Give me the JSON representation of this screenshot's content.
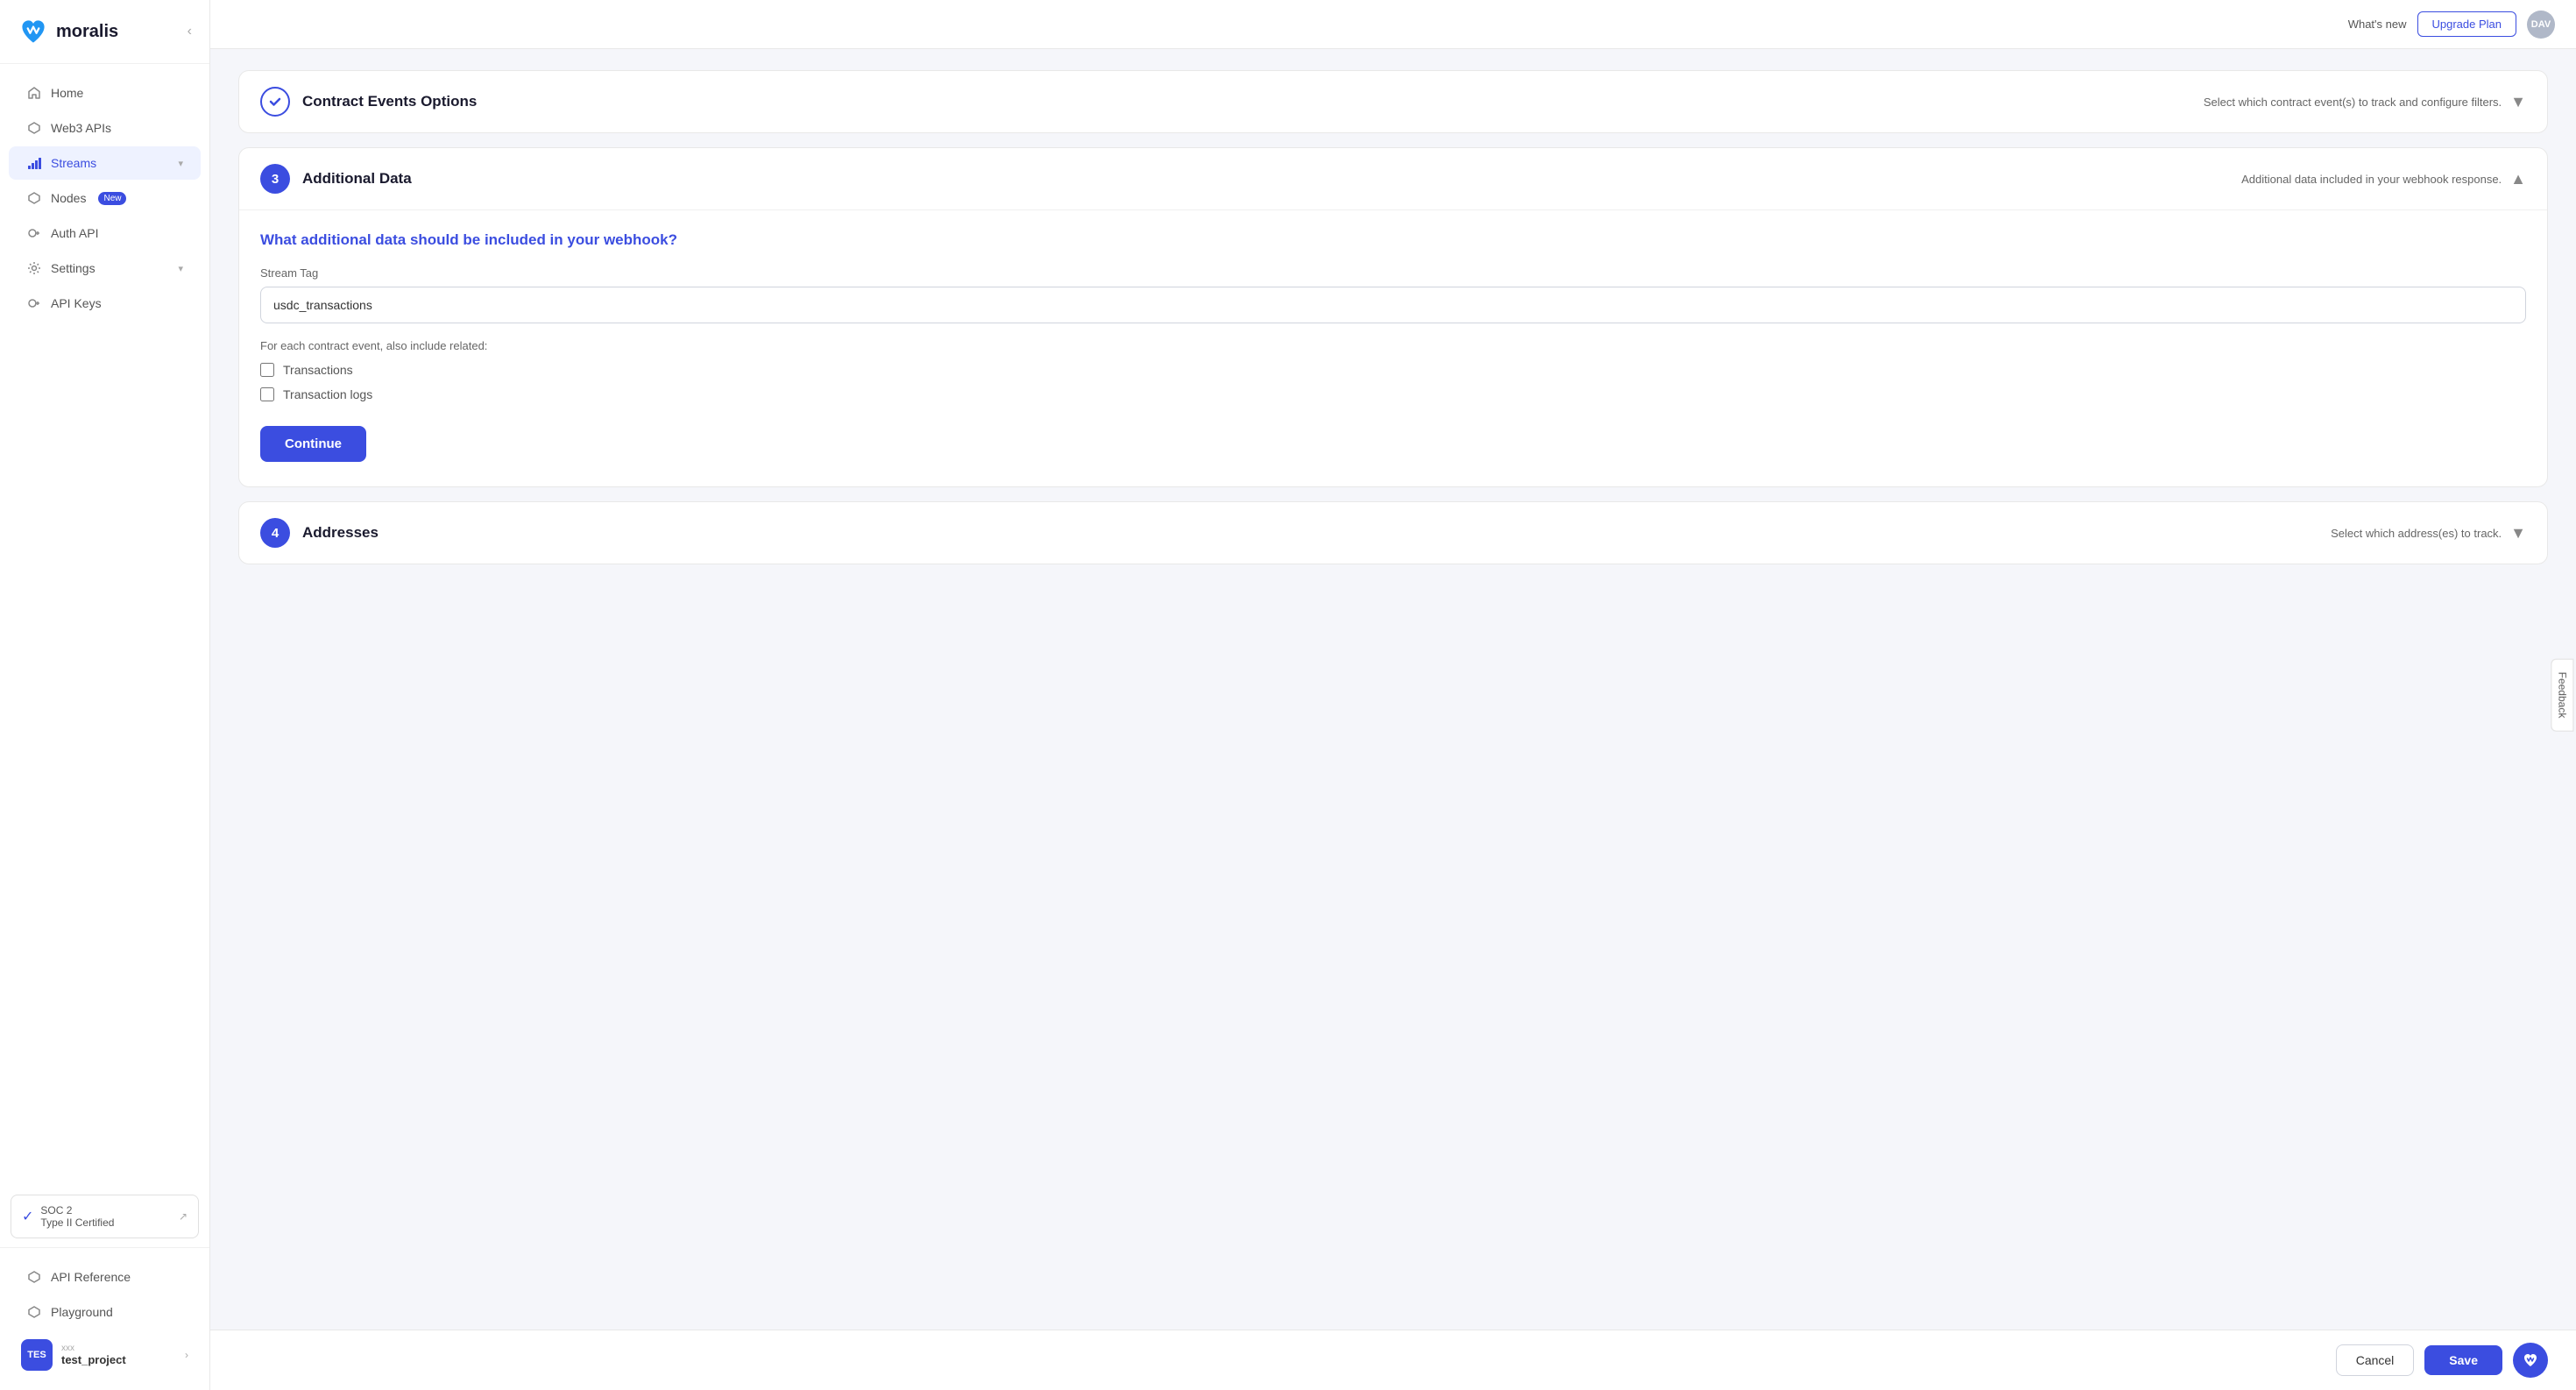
{
  "app": {
    "name": "moralis",
    "logo_text": "moralis"
  },
  "header": {
    "whats_new": "What's new",
    "upgrade_label": "Upgrade Plan",
    "avatar_label": "DAV"
  },
  "sidebar": {
    "items": [
      {
        "id": "home",
        "label": "Home",
        "icon": "🏠",
        "active": false,
        "badge": null,
        "chevron": false
      },
      {
        "id": "web3apis",
        "label": "Web3 APIs",
        "icon": "⬡",
        "active": false,
        "badge": null,
        "chevron": false
      },
      {
        "id": "streams",
        "label": "Streams",
        "icon": "📶",
        "active": true,
        "badge": null,
        "chevron": true
      },
      {
        "id": "nodes",
        "label": "Nodes",
        "icon": "⬡",
        "active": false,
        "badge": "New",
        "chevron": false
      },
      {
        "id": "authapi",
        "label": "Auth API",
        "icon": "🔑",
        "active": false,
        "badge": null,
        "chevron": false
      },
      {
        "id": "settings",
        "label": "Settings",
        "icon": "⚙️",
        "active": false,
        "badge": null,
        "chevron": true
      },
      {
        "id": "apikeys",
        "label": "API Keys",
        "icon": "🔑",
        "active": false,
        "badge": null,
        "chevron": false
      }
    ],
    "soc2": {
      "label": "SOC 2",
      "sublabel": "Type II Certified"
    },
    "bottom_items": [
      {
        "id": "apireference",
        "label": "API Reference",
        "icon": "⬡"
      },
      {
        "id": "playground",
        "label": "Playground",
        "icon": "⬡"
      }
    ],
    "project": {
      "avatar": "TES",
      "label": "xxx",
      "name": "test_project"
    }
  },
  "sections": {
    "contract_events": {
      "title": "Contract Events Options",
      "subtitle": "Select which contract event(s) to track and configure filters.",
      "step": "check",
      "collapsed": true,
      "chevron": "▼"
    },
    "additional_data": {
      "title": "Additional Data",
      "subtitle": "Additional data included in your webhook response.",
      "step": "3",
      "collapsed": false,
      "chevron": "▲",
      "question": "What additional data should be included in your webhook?",
      "stream_tag_label": "Stream Tag",
      "stream_tag_value": "usdc_transactions",
      "include_label": "For each contract event, also include related:",
      "checkboxes": [
        {
          "id": "transactions",
          "label": "Transactions",
          "checked": false
        },
        {
          "id": "transaction_logs",
          "label": "Transaction logs",
          "checked": false
        }
      ],
      "continue_label": "Continue"
    },
    "addresses": {
      "title": "Addresses",
      "subtitle": "Select which address(es) to track.",
      "step": "4",
      "collapsed": true,
      "chevron": "▼"
    }
  },
  "footer": {
    "cancel_label": "Cancel",
    "save_label": "Save"
  },
  "feedback": {
    "label": "Feedback"
  }
}
